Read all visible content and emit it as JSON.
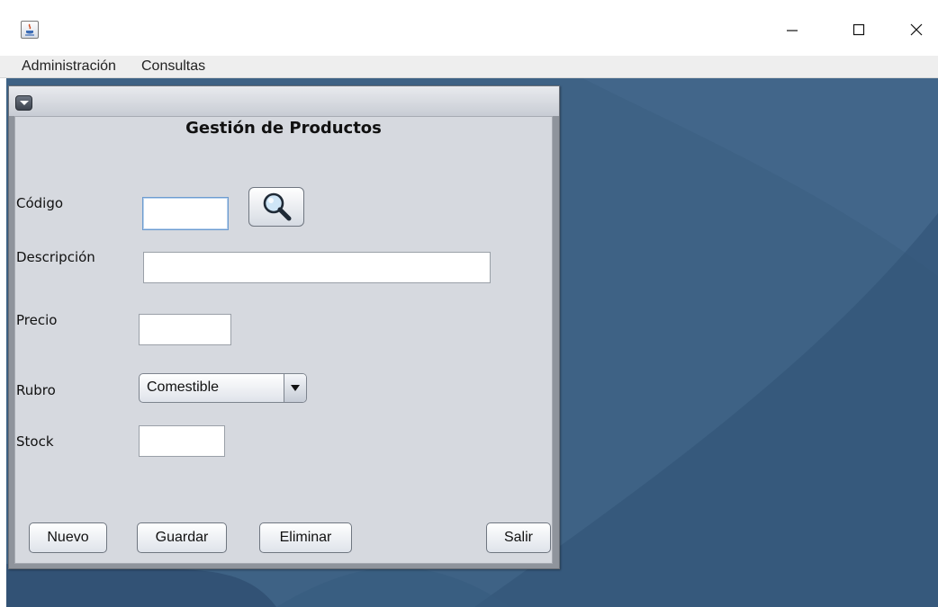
{
  "window": {
    "minimize_glyph": "—",
    "maximize_glyph": "☐",
    "close_glyph": "✕"
  },
  "menu": {
    "items": [
      {
        "label": "Administración"
      },
      {
        "label": "Consultas"
      }
    ]
  },
  "form": {
    "title": "Gestión de Productos",
    "fields": {
      "codigo": {
        "label": "Código",
        "value": ""
      },
      "descripcion": {
        "label": "Descripción",
        "value": ""
      },
      "precio": {
        "label": "Precio",
        "value": ""
      },
      "rubro": {
        "label": "Rubro",
        "selected": "Comestible"
      },
      "stock": {
        "label": "Stock",
        "value": ""
      }
    },
    "buttons": {
      "nuevo": "Nuevo",
      "guardar": "Guardar",
      "eliminar": "Eliminar",
      "salir": "Salir"
    }
  },
  "colors": {
    "desktop": "#3e6285",
    "panel": "#d6d9df",
    "focus_border": "#6d9bcf"
  },
  "icons": {
    "app": "java-icon",
    "search": "search-icon",
    "frame_menu": "chevron-down-icon",
    "combo_arrow": "dropdown-arrow-icon"
  }
}
